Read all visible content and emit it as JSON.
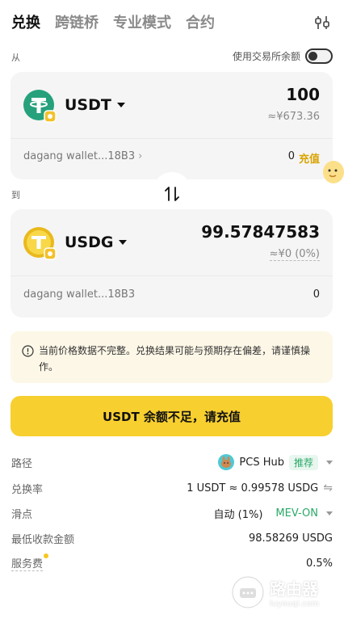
{
  "tabs": [
    "兑换",
    "跨链桥",
    "专业模式",
    "合约"
  ],
  "settings_icon": "sliders-icon",
  "from": {
    "label": "从",
    "use_exchange_balance": "使用交易所余额",
    "use_exchange_toggle_on": false,
    "token": "USDT",
    "amount": "100",
    "fiat": "≈¥673.36",
    "wallet": "dagang wallet...18B3",
    "balance": "0",
    "deposit": "充值"
  },
  "swap_icon": "swap-arrows-icon",
  "to": {
    "label": "到",
    "token": "USDG",
    "amount": "99.57847583",
    "fiat": "≈¥0 (0%)",
    "wallet": "dagang wallet...18B3",
    "balance": "0"
  },
  "warning": "当前价格数据不完整。兑换结果可能与预期存在偏差，请谨慎操作。",
  "cta": "USDT 余额不足，请充值",
  "details": {
    "route_label": "路径",
    "route_value": "PCS Hub",
    "route_tag": "推荐",
    "rate_label": "兑换率",
    "rate_value": "1 USDT ≈ 0.99578 USDG",
    "slippage_label": "滑点",
    "slippage_value": "自动 (1%)",
    "mev": "MEV-ON",
    "min_receive_label": "最低收款金额",
    "min_receive_value": "98.58269 USDG",
    "fee_label": "服务费",
    "fee_value": "0.5%"
  },
  "watermark": {
    "title": "路由器",
    "subtitle": "luyouqi.com"
  },
  "colors": {
    "accent": "#f7cf2f",
    "green": "#2aa868",
    "tether": "#26a17b"
  }
}
